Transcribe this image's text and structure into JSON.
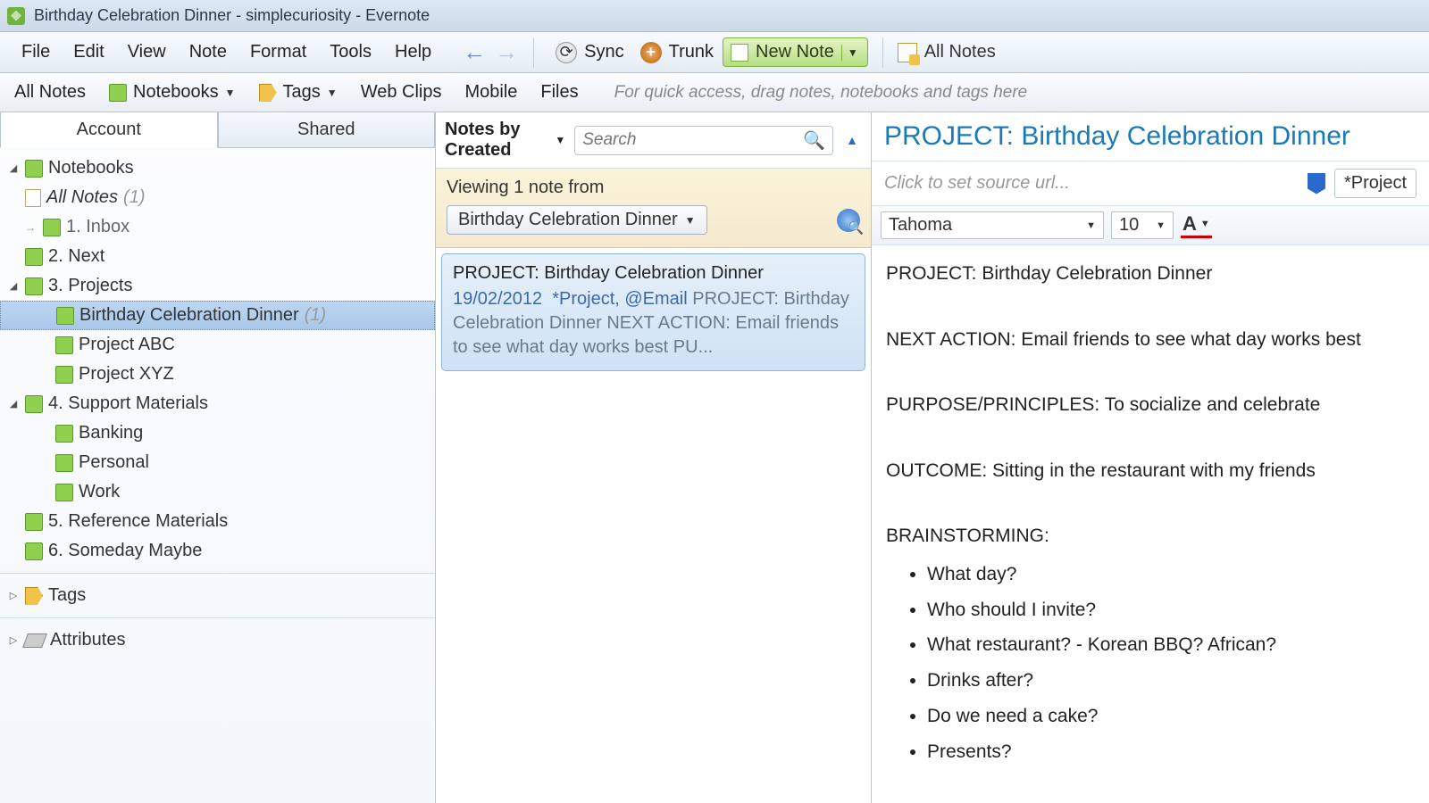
{
  "window": {
    "title": "Birthday Celebration Dinner - simplecuriosity - Evernote"
  },
  "menubar": {
    "items": [
      "File",
      "Edit",
      "View",
      "Note",
      "Format",
      "Tools",
      "Help"
    ],
    "sync": "Sync",
    "trunk": "Trunk",
    "new_note": "New Note",
    "all_notes": "All Notes"
  },
  "filterbar": {
    "all_notes": "All Notes",
    "notebooks": "Notebooks",
    "tags": "Tags",
    "web_clips": "Web Clips",
    "mobile": "Mobile",
    "files": "Files",
    "hint": "For quick access, drag notes, notebooks and tags here"
  },
  "sidebar": {
    "tabs": {
      "account": "Account",
      "shared": "Shared"
    },
    "root_notebooks": "Notebooks",
    "all_notes": {
      "label": "All Notes",
      "count": "(1)"
    },
    "items": [
      {
        "label": "1. Inbox"
      },
      {
        "label": "2. Next"
      },
      {
        "label": "3. Projects",
        "expanded": true,
        "children": [
          {
            "label": "Birthday Celebration Dinner",
            "count": "(1)",
            "selected": true
          },
          {
            "label": "Project ABC"
          },
          {
            "label": "Project XYZ"
          }
        ]
      },
      {
        "label": "4. Support Materials",
        "expanded": true,
        "children": [
          {
            "label": "Banking"
          },
          {
            "label": "Personal"
          },
          {
            "label": "Work"
          }
        ]
      },
      {
        "label": "5. Reference Materials"
      },
      {
        "label": "6. Someday Maybe"
      }
    ],
    "tags": "Tags",
    "attributes": "Attributes"
  },
  "notelist": {
    "sort_label": "Notes by Created",
    "search_placeholder": "Search",
    "viewing_label": "Viewing 1 note from",
    "notebook_selected": "Birthday Celebration Dinner",
    "card": {
      "title": "PROJECT: Birthday Celebration Dinner",
      "date": "19/02/2012",
      "tags": "*Project, @Email",
      "snippet": "PROJECT: Birthday Celebration Dinner NEXT ACTION: Email friends to see what day works best PU..."
    }
  },
  "editor": {
    "title": "PROJECT: Birthday Celebration Dinner",
    "source_placeholder": "Click to set source url...",
    "tag_field": "*Project",
    "font": "Tahoma",
    "size": "10",
    "body": {
      "project": "PROJECT: Birthday Celebration Dinner",
      "next_action": "NEXT ACTION: Email friends to see what day works best",
      "purpose": "PURPOSE/PRINCIPLES: To socialize and celebrate",
      "outcome": "OUTCOME: Sitting in the restaurant with my friends",
      "brainstorming": "BRAINSTORMING:",
      "bullets": [
        "What day?",
        "Who should I invite?",
        "What restaurant? - Korean BBQ? African?",
        "Drinks after?",
        "Do we need a cake?",
        "Presents?"
      ]
    }
  }
}
